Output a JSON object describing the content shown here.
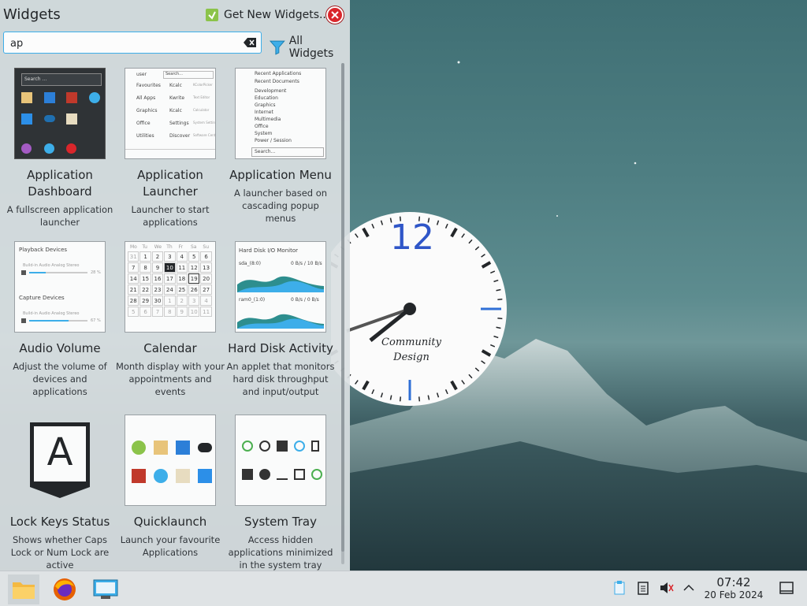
{
  "panel": {
    "title": "Widgets",
    "get_new_label": "Get New Widgets...",
    "search": {
      "value": "ap",
      "placeholder": "Search..."
    },
    "filter_label": "All Widgets"
  },
  "widgets": [
    {
      "name": "Application Dashboard",
      "desc": "A fullscreen application launcher"
    },
    {
      "name": "Application Launcher",
      "desc": "Launcher to start applications"
    },
    {
      "name": "Application Menu",
      "desc": "A launcher based on cascading popup menus"
    },
    {
      "name": "Audio Volume",
      "desc": "Adjust the volume of devices and applications"
    },
    {
      "name": "Calendar",
      "desc": "Month display with your appointments and events"
    },
    {
      "name": "Hard Disk Activity",
      "desc": "An applet that monitors hard disk throughput and input/output"
    },
    {
      "name": "Lock Keys Status",
      "desc": "Shows whether Caps Lock or Num Lock are active"
    },
    {
      "name": "Quicklaunch",
      "desc": "Launch your favourite Applications"
    },
    {
      "name": "System Tray",
      "desc": "Access hidden applications minimized in the system tray"
    }
  ],
  "thumbs": {
    "dashboard": {
      "search": "Search ..."
    },
    "launcher": {
      "user": "user",
      "search": "Search...",
      "left": [
        "Favourites",
        "All Apps",
        "Graphics",
        "Office",
        "Utilities"
      ],
      "right": [
        "Kcalc",
        "Kwrite",
        "Kcalc",
        "Settings",
        "Discover"
      ],
      "right_sub": [
        "KColorPicker",
        "Text Editor",
        "Calculator",
        "System Settings",
        "Software Center"
      ]
    },
    "menu": {
      "items": [
        "Recent Applications",
        "Recent Documents",
        "Development",
        "Education",
        "Graphics",
        "Internet",
        "Multimedia",
        "Office",
        "System",
        "Power / Session"
      ],
      "search": "Search..."
    },
    "audio": {
      "playback_title": "Playback Devices",
      "playback_device": "Build-in Audio Analog Stereo",
      "playback_pct": "28 %",
      "capture_title": "Capture Devices",
      "capture_device": "Build-in Audio Analog Stereo",
      "capture_pct": "67 %"
    },
    "calendar": {
      "days": [
        "Mo",
        "Tu",
        "We",
        "Th",
        "Fr",
        "Sa",
        "Su"
      ],
      "rows": [
        [
          "31",
          "1",
          "2",
          "3",
          "4",
          "5",
          "6"
        ],
        [
          "7",
          "8",
          "9",
          "10",
          "11",
          "12",
          "13"
        ],
        [
          "14",
          "15",
          "16",
          "17",
          "18",
          "19",
          "20"
        ],
        [
          "21",
          "22",
          "23",
          "24",
          "25",
          "26",
          "27"
        ],
        [
          "28",
          "29",
          "30",
          "1",
          "2",
          "3",
          "4"
        ],
        [
          "5",
          "6",
          "7",
          "8",
          "9",
          "10",
          "11"
        ]
      ]
    },
    "disk": {
      "title": "Hard Disk I/O Monitor",
      "dev1": "sda_(8:0)",
      "rate1": "0 B/s / 10 B/s",
      "dev2": "ram0_(1:0)",
      "rate2": "0 B/s / 0 B/s"
    },
    "lockkeys": {
      "letter": "A"
    }
  },
  "clock_widget": {
    "twelve": "12",
    "brand_line1": "Community",
    "brand_line2": "Design"
  },
  "taskbar": {
    "time": "07:42",
    "date": "20 Feb 2024",
    "apps": [
      "file-manager-icon",
      "firefox-icon",
      "system-settings-icon"
    ]
  },
  "colors": {
    "accent": "#3daee9",
    "panel_bg": "#dae0e2",
    "close_red": "#d9262b",
    "clock_hands": "#232629",
    "clock_marker_blue": "#2f6fd6"
  }
}
